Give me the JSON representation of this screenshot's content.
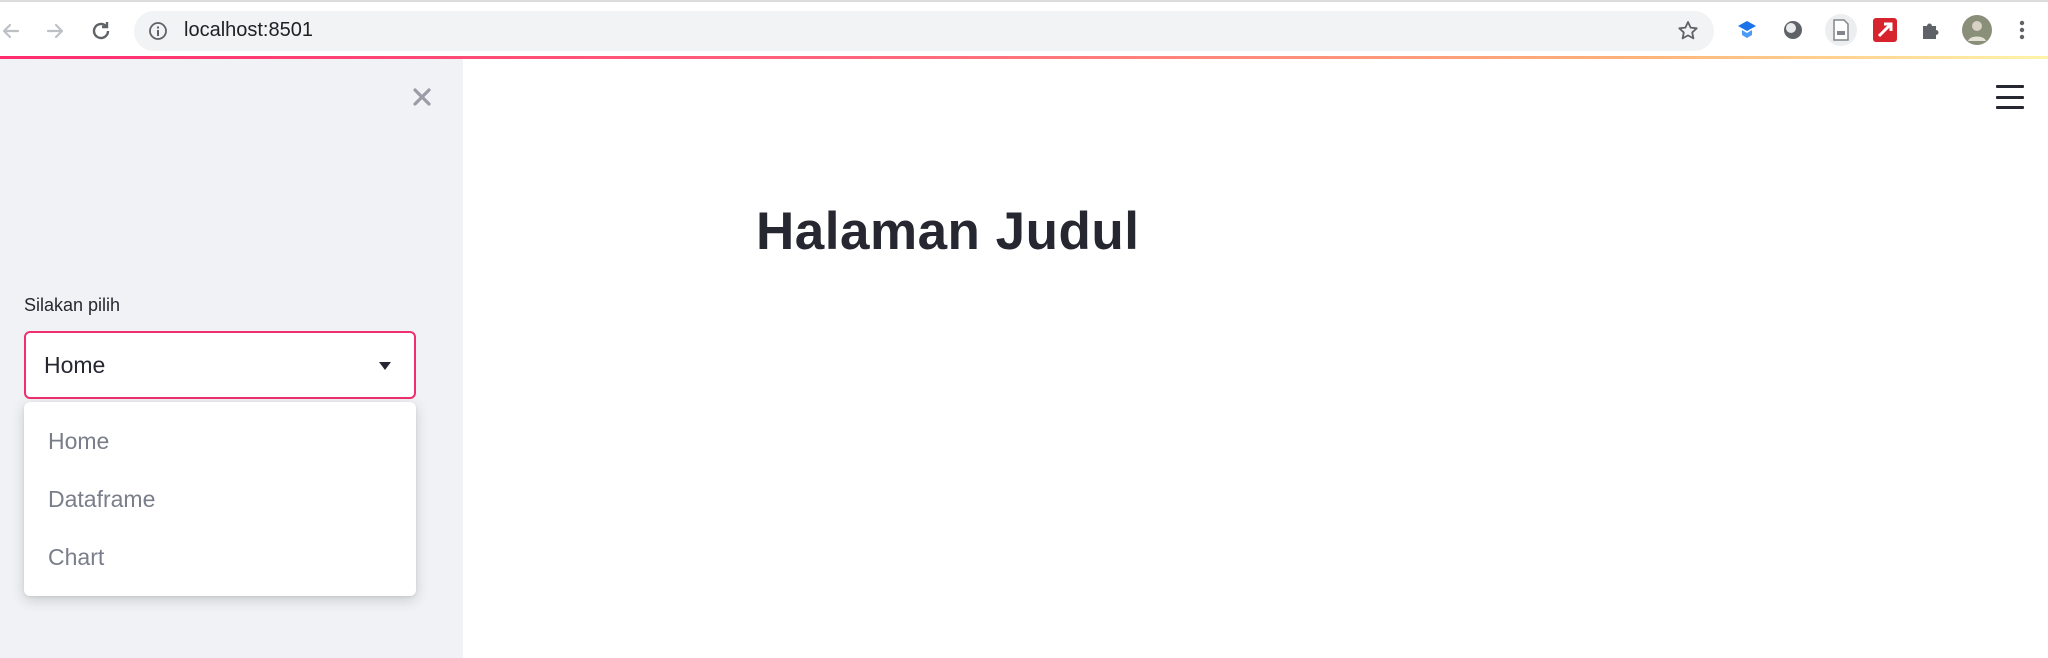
{
  "browser": {
    "url": "localhost:8501",
    "icons": [
      "back-arrow-icon",
      "forward-arrow-icon",
      "reload-icon",
      "info-icon",
      "bookmark-star-icon",
      "extension-icon",
      "extension-icon",
      "extension-icon",
      "extension-icon",
      "puzzle-icon",
      "avatar",
      "menu-dots-icon"
    ]
  },
  "sidebar": {
    "close_icon": "close-icon",
    "select": {
      "label": "Silakan pilih",
      "value": "Home",
      "options": [
        "Home",
        "Dataframe",
        "Chart"
      ]
    }
  },
  "main": {
    "title": "Halaman Judul",
    "menu_icon": "hamburger-menu-icon"
  },
  "colors": {
    "accent": "#f0306e",
    "sidebar_bg": "#f0f2f6",
    "text": "#262730"
  }
}
